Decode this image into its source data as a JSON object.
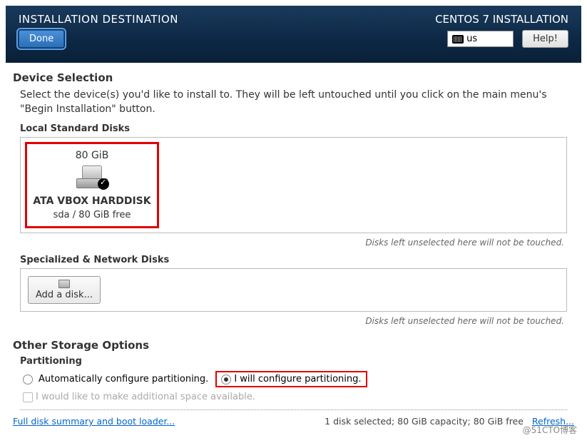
{
  "header": {
    "title": "INSTALLATION DESTINATION",
    "done_label": "Done",
    "installer_title": "CENTOS 7 INSTALLATION",
    "kb_layout": "us",
    "help_label": "Help!"
  },
  "device_selection": {
    "heading": "Device Selection",
    "description": "Select the device(s) you'd like to install to.  They will be left untouched until you click on the main menu's \"Begin Installation\" button.",
    "local_disks_label": "Local Standard Disks",
    "disk": {
      "size": "80 GiB",
      "name": "ATA VBOX HARDDISK",
      "details": "sda   /   80 GiB free"
    },
    "untouched_note": "Disks left unselected here will not be touched.",
    "network_disks_label": "Specialized & Network Disks",
    "add_disk_label": "Add a disk..."
  },
  "storage": {
    "heading": "Other Storage Options",
    "partitioning_label": "Partitioning",
    "auto_label": "Automatically configure partitioning.",
    "manual_label": "I will configure partitioning.",
    "additional_space_label": "I would like to make additional space available."
  },
  "footer": {
    "summary_link": "Full disk summary and boot loader...",
    "status": "1 disk selected; 80 GiB capacity; 80 GiB free",
    "refresh_link": "Refresh...",
    "watermark": "@51CTO博客"
  }
}
